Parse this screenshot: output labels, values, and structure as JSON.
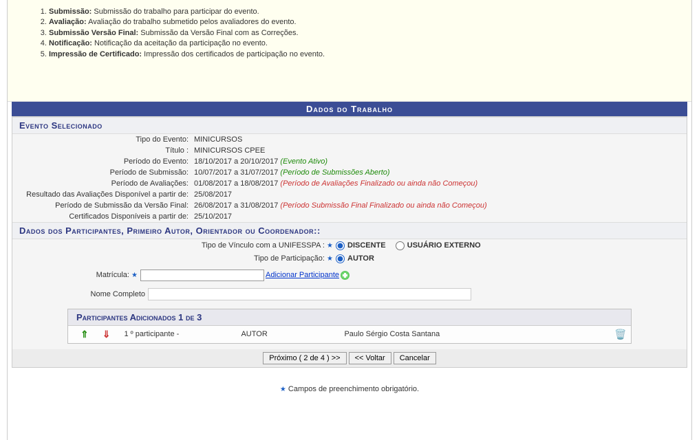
{
  "steps": [
    {
      "title": "Submissão:",
      "desc": " Submissão do trabalho para participar do evento."
    },
    {
      "title": "Avaliação:",
      "desc": " Avaliação do trabalho submetido pelos avaliadores do evento."
    },
    {
      "title": "Submissão Versão Final:",
      "desc": " Submissão da Versão Final com as Correções."
    },
    {
      "title": "Notificação:",
      "desc": " Notificação da aceitação da participação no evento."
    },
    {
      "title": "Impressão de Certificado:",
      "desc": " Impressão dos certificados de participação no evento."
    }
  ],
  "bar_title": "Dados do Trabalho",
  "evento_header": "Evento Selecionado",
  "evento": {
    "l_tipo": "Tipo do Evento:",
    "v_tipo": "MINICURSOS",
    "l_titulo": "Título :",
    "v_titulo": "MINICURSOS CPEE",
    "l_periodo_evento": "Período do Evento:",
    "v_periodo_evento": "18/10/2017 a 20/10/2017",
    "s_periodo_evento": "(Evento Ativo)",
    "l_periodo_sub": "Período de Submissão:",
    "v_periodo_sub": "10/07/2017 a 31/07/2017",
    "s_periodo_sub": "(Período de Submissões Aberto)",
    "l_periodo_av": "Período de Avaliações:",
    "v_periodo_av": "01/08/2017 a 18/08/2017",
    "s_periodo_av": "(Período de Avaliações Finalizado ou ainda não Começou)",
    "l_resultado": "Resultado das Avaliações Disponível a partir de:",
    "v_resultado": "25/08/2017",
    "l_periodo_final": "Período de Submissão da Versão Final:",
    "v_periodo_final": "26/08/2017 a 31/08/2017",
    "s_periodo_final": "(Período Submissão Final Finalizado ou ainda não Começou)",
    "l_cert": "Certificados Disponíveis a partir de:",
    "v_cert": "25/10/2017"
  },
  "participantes_header": "Dados dos Participantes, Primeiro Autor, Orientador ou Coordenador::",
  "form": {
    "l_vinculo": "Tipo de Vínculo com a UNIFESSPA :",
    "opt_discente": "DISCENTE",
    "opt_externo": "USUÁRIO EXTERNO",
    "l_tipopart": "Tipo de Participação:",
    "opt_autor": "AUTOR",
    "l_matricula": "Matrícula:",
    "link_add": "Adicionar Participante",
    "l_nome": "Nome Completo"
  },
  "added_header": "Participantes Adicionados 1 de 3",
  "added": {
    "idx": "1 º participante -",
    "role": "AUTOR",
    "name": "Paulo Sérgio Costa Santana"
  },
  "buttons": {
    "next": "Próximo ( 2 de 4 ) >>",
    "back": "<< Voltar",
    "cancel": "Cancelar"
  },
  "footer": "Campos de preenchimento obrigatório.",
  "star": "★"
}
